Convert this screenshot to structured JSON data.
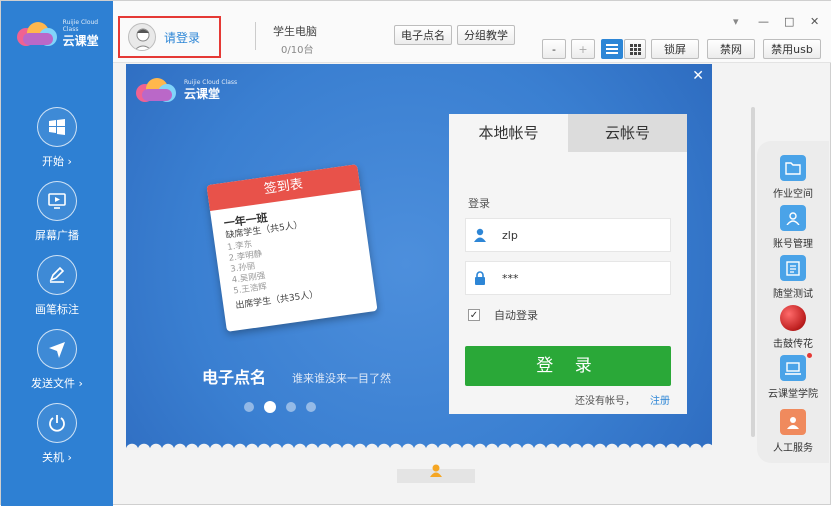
{
  "app": {
    "logo": {
      "en": "Ruijie Cloud Class",
      "cn": "云课堂"
    },
    "colors": {
      "sidebar": "#2e80d3",
      "dialog": "#3a7fd1",
      "login_button": "#2aa838",
      "highlight_border": "#e53935",
      "link": "#2d86d6"
    }
  },
  "sidebar": {
    "items": [
      {
        "label": "开始 ›",
        "icon": "windows-icon"
      },
      {
        "label": "屏幕广播",
        "icon": "monitor-play-icon"
      },
      {
        "label": "画笔标注",
        "icon": "pen-icon"
      },
      {
        "label": "发送文件 ›",
        "icon": "send-icon"
      },
      {
        "label": "关机 ›",
        "icon": "power-icon"
      }
    ]
  },
  "header": {
    "login_label": "请登录",
    "pc_title": "学生电脑",
    "pc_count": "0/10台",
    "buttons": [
      "电子点名",
      "分组教学"
    ],
    "zoom_minus": "-",
    "zoom_plus": "+",
    "toolbar": [
      "锁屏",
      "禁网",
      "禁用usb"
    ],
    "window_controls": [
      "▾",
      "—",
      "□",
      "✕"
    ]
  },
  "dialog": {
    "logo": {
      "en": "Ruijie Cloud Class",
      "cn": "云课堂"
    },
    "close": "✕",
    "card": {
      "title": "签到表",
      "class_name": "一年一班",
      "absent": "缺席学生（共5人）",
      "list": [
        "1.李东",
        "2.李明静",
        "3.孙丽",
        "4.吴刚强",
        "5.王浩辉"
      ],
      "present": "出席学生（共35人）"
    },
    "feature_title": "电子点名",
    "feature_subtitle": "谁来谁没来一目了然",
    "carousel": {
      "count": 4,
      "active_index": 1
    }
  },
  "login": {
    "tabs": [
      "本地帐号",
      "云帐号"
    ],
    "active_tab": 0,
    "label": "登录",
    "username": "zlp",
    "password": "***",
    "auto_login_label": "自动登录",
    "auto_login_checked": true,
    "checkmark": "✓",
    "submit": "登 录",
    "no_account": "还没有帐号，",
    "register": "注册"
  },
  "right_toolbar": {
    "items": [
      {
        "label": "作业空间",
        "icon": "folder-icon"
      },
      {
        "label": "账号管理",
        "icon": "user-icon"
      },
      {
        "label": "随堂测试",
        "icon": "quiz-icon"
      },
      {
        "label": "击鼓传花",
        "icon": "ball-icon"
      },
      {
        "label": "云课堂学院",
        "icon": "laptop-icon"
      },
      {
        "label": "人工服务",
        "icon": "service-icon"
      }
    ]
  }
}
